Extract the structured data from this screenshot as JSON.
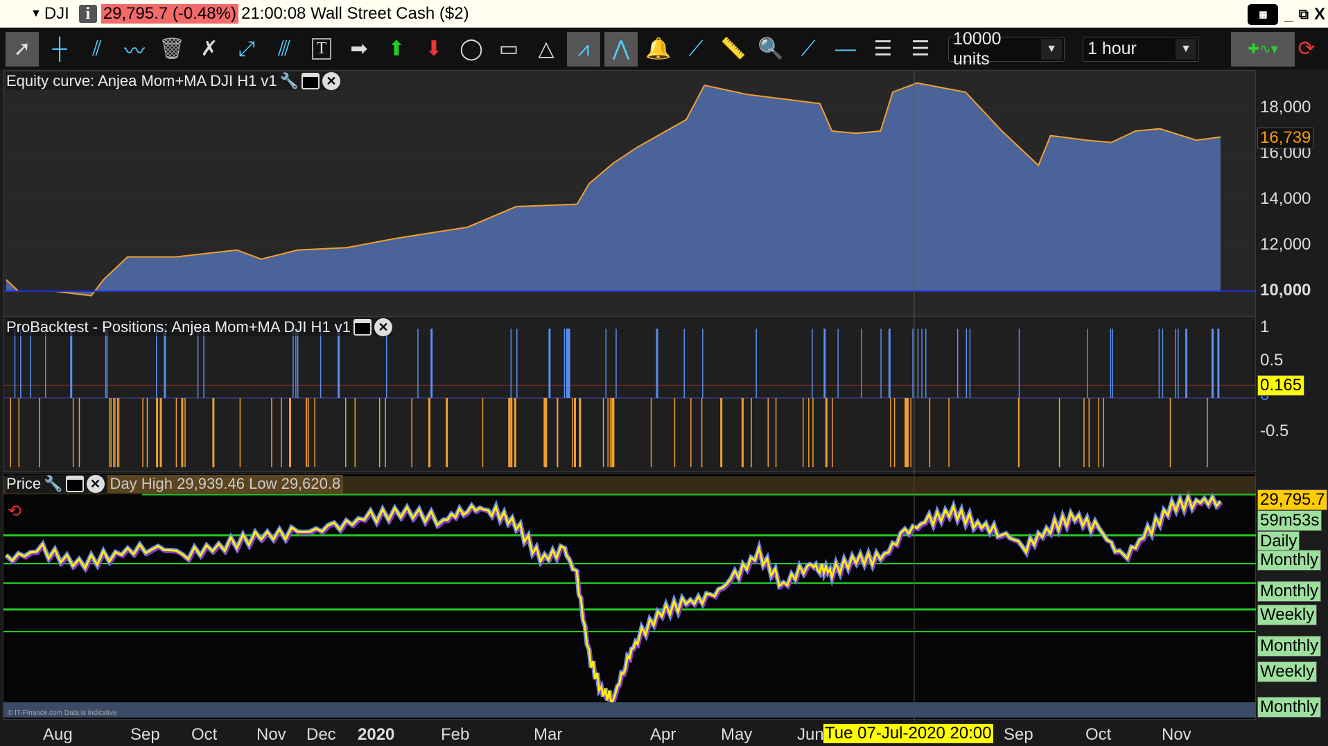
{
  "titlebar": {
    "symbol": "DJI",
    "price_change": "29,795.7 (-0.48%)",
    "time": "21:00:08",
    "instrument": "Wall Street Cash ($2)",
    "keyboard": "▦",
    "minimize": "_",
    "restore": "⧉",
    "close": "X"
  },
  "toolbar": {
    "units": "10000 units",
    "timeframe": "1 hour",
    "tools": [
      "pointer",
      "vertical-line",
      "parallel-channel",
      "trend-channel",
      "trash",
      "tools",
      "segment",
      "parallel-lines",
      "text",
      "arrow-right",
      "arrow-up",
      "arrow-down",
      "ellipse",
      "rectangle",
      "triangle",
      "horizontal-channel",
      "triangle-pattern",
      "alert-bell",
      "line",
      "ruler",
      "zoom",
      "half-line",
      "horizontal-line",
      "fibonacci",
      "fibonacci-fan"
    ]
  },
  "equity": {
    "title": "Equity curve: Anjea Mom+MA DJI H1 v1",
    "current": "16,739",
    "ticks": [
      "18,000",
      "16,000",
      "14,000",
      "12,000",
      "10,000"
    ]
  },
  "positions": {
    "title": "ProBacktest - Positions: Anjea Mom+MA DJI H1 v1",
    "current": "0.165",
    "ticks": [
      "1",
      "0.5",
      "0",
      "-0.5"
    ]
  },
  "price": {
    "title": "Price",
    "info": "Day High 29,939.46 Low 29,620.8",
    "current": "29,795.7",
    "countdown": "59m53s",
    "levels": [
      "Daily",
      "Monthly",
      "Monthly",
      "Weekly",
      "Monthly",
      "Weekly",
      "Monthly"
    ],
    "footer": "© IT-Finance.com Data is indicative"
  },
  "timeaxis": {
    "labels": [
      "Aug",
      "Sep",
      "Oct",
      "Nov",
      "Dec",
      "2020",
      "Feb",
      "Mar",
      "Apr",
      "May",
      "Jun",
      "Sep",
      "Oct",
      "Nov"
    ],
    "cursor": "Tue 07-Jul-2020 20:00"
  },
  "chart_data": [
    {
      "type": "area",
      "title": "Equity curve: Anjea Mom+MA DJI H1 v1",
      "ylim": [
        9000,
        19500
      ],
      "x": [
        0,
        1,
        4,
        7,
        8,
        10,
        14,
        19,
        21,
        24,
        28,
        32,
        38,
        42,
        47,
        48,
        50,
        52,
        56,
        57.5,
        61,
        67,
        68,
        70,
        72,
        73,
        75,
        79,
        82,
        85,
        86,
        89,
        91,
        93,
        95,
        98,
        100
      ],
      "y": [
        10500,
        10000,
        10000,
        9800,
        10500,
        11500,
        11500,
        11800,
        11400,
        11800,
        11900,
        12300,
        12800,
        13700,
        13800,
        14700,
        15600,
        16300,
        17500,
        19000,
        18600,
        18200,
        17000,
        16900,
        17000,
        18700,
        19100,
        18700,
        17000,
        15500,
        16800,
        16600,
        16500,
        17000,
        17100,
        16600,
        16739
      ],
      "colors": {
        "fill": "#4a6399",
        "line": "#f0a030"
      }
    },
    {
      "type": "line",
      "title": "Price",
      "ylim": [
        18000,
        30500
      ],
      "x": [
        0,
        3,
        6,
        9,
        12,
        15,
        18,
        21,
        24,
        27,
        30,
        33,
        36,
        38,
        40,
        42,
        44,
        46,
        47,
        48,
        49,
        50,
        51,
        52,
        54,
        56,
        58,
        60,
        62,
        64,
        66,
        67,
        68,
        70,
        72,
        74,
        76,
        78,
        80,
        82,
        84,
        86,
        88,
        90,
        92,
        94,
        96,
        98,
        100
      ],
      "y": [
        26500,
        27000,
        26200,
        26800,
        27200,
        26800,
        27300,
        27800,
        28000,
        28300,
        28900,
        29200,
        28700,
        29400,
        29300,
        28500,
        26500,
        27000,
        25500,
        21000,
        19000,
        18500,
        20500,
        22000,
        23500,
        24000,
        24300,
        25500,
        26800,
        25000,
        26200,
        26000,
        25800,
        26500,
        26500,
        28000,
        28700,
        29200,
        28500,
        28000,
        27200,
        28300,
        28900,
        28200,
        26500,
        28000,
        29500,
        29800,
        29795.7
      ]
    }
  ]
}
